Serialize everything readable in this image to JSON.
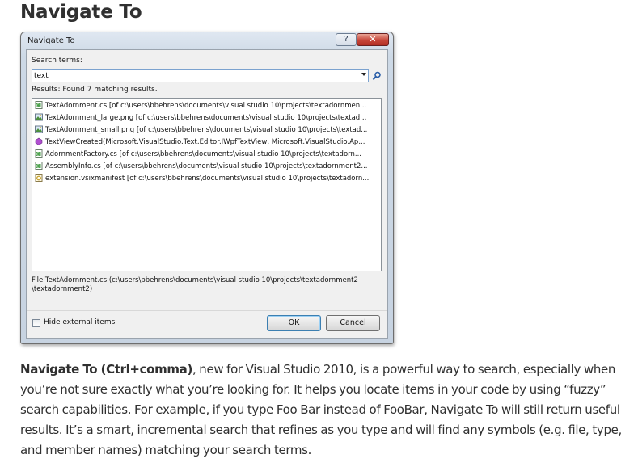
{
  "heading": "Navigate To",
  "dialog": {
    "title": "Navigate To",
    "help_glyph": "?",
    "close_glyph": "✕",
    "search_label": "Search terms:",
    "search_value": "text",
    "results_label": "Results: Found 7 matching results.",
    "results": [
      {
        "icon": "csharp-file-icon",
        "text": "TextAdornment.cs [of c:\\users\\bbehrens\\documents\\visual studio 10\\projects\\textadornmen..."
      },
      {
        "icon": "image-file-icon",
        "text": "TextAdornment_large.png [of c:\\users\\bbehrens\\documents\\visual studio 10\\projects\\textad..."
      },
      {
        "icon": "image-file-icon",
        "text": "TextAdornment_small.png [of c:\\users\\bbehrens\\documents\\visual studio 10\\projects\\textad..."
      },
      {
        "icon": "method-icon",
        "text": "TextViewCreated(Microsoft.VisualStudio.Text.Editor.IWpfTextView, Microsoft.VisualStudio.Ap..."
      },
      {
        "icon": "csharp-file-icon",
        "text": "AdornmentFactory.cs [of c:\\users\\bbehrens\\documents\\visual studio 10\\projects\\textadorn..."
      },
      {
        "icon": "csharp-file-icon",
        "text": "AssemblyInfo.cs [of c:\\users\\bbehrens\\documents\\visual studio 10\\projects\\textadornment2..."
      },
      {
        "icon": "manifest-file-icon",
        "text": "extension.vsixmanifest [of c:\\users\\bbehrens\\documents\\visual studio 10\\projects\\textadorn..."
      }
    ],
    "detail_line1": "File TextAdornment.cs (c:\\users\\bbehrens\\documents\\visual studio 10\\projects\\textadornment2",
    "detail_line2": "\\textadornment2)",
    "hide_external_label": "Hide external items",
    "hide_external_checked": false,
    "ok_label": "OK",
    "cancel_label": "Cancel"
  },
  "paragraph": {
    "lead": "Navigate To (Ctrl+comma)",
    "body": ", new for Visual Studio 2010, is a powerful way to search, especially when you’re not sure exactly what you’re looking for. It helps you locate items in your code by using “fuzzy” search capabilities. For example, if you type Foo Bar instead of FooBar, Navigate To will still return useful results. It’s a smart, incremental search that refines as you type and will find any symbols (e.g. file, type, and member names) matching your search terms."
  },
  "colors": {
    "accent": "#7ba2cf",
    "close_button": "#c7463a",
    "text": "#303030"
  }
}
